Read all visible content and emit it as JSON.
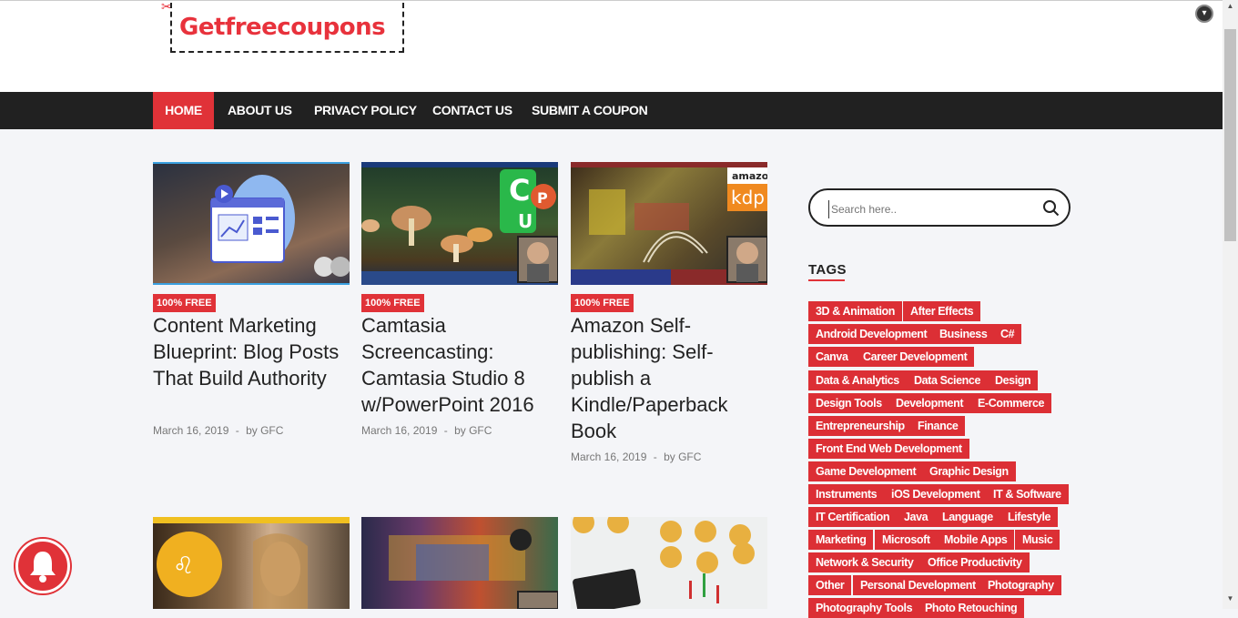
{
  "header": {
    "logo_text": "Getfreecoupons"
  },
  "nav": {
    "items": [
      {
        "label": "HOME"
      },
      {
        "label": "ABOUT US"
      },
      {
        "label": "PRIVACY POLICY"
      },
      {
        "label": "CONTACT US"
      },
      {
        "label": "SUBMIT A COUPON"
      }
    ]
  },
  "posts": [
    {
      "badge": "100% FREE",
      "title": "Content Marketing Blueprint: Blog Posts That Build Authority",
      "date": "March 16, 2019",
      "sep": "-",
      "author": "by GFC"
    },
    {
      "badge": "100% FREE",
      "title": "Camtasia Screencasting: Camtasia Studio 8 w/PowerPoint 2016",
      "date": "March 16, 2019",
      "sep": "-",
      "author": "by GFC"
    },
    {
      "badge": "100% FREE",
      "title": "Amazon Self-publishing: Self-publish a Kindle/Paperback Book",
      "date": "March 16, 2019",
      "sep": "-",
      "author": "by GFC"
    }
  ],
  "thumb_labels": {
    "amazon": "amazon",
    "kdp": "kdp"
  },
  "sidebar": {
    "search_placeholder": "Search here..",
    "tags_title": "TAGS",
    "tags": [
      "3D & Animation",
      "After Effects",
      "Android Development",
      "Business",
      "C#",
      "Canva",
      "Career Development",
      "Data & Analytics",
      "Data Science",
      "Design",
      "Design Tools",
      "Development",
      "E-Commerce",
      "Entrepreneurship",
      "Finance",
      "Front End Web Development",
      "Game Development",
      "Graphic Design",
      "Instruments",
      "iOS Development",
      "IT & Software",
      "IT Certification",
      "Java",
      "Language",
      "Lifestyle",
      "Marketing",
      "Microsoft",
      "Mobile Apps",
      "Music",
      "Network & Security",
      "Office Productivity",
      "Other",
      "Personal Development",
      "Photography",
      "Photography Tools",
      "Photo Retouching"
    ]
  },
  "colors": {
    "accent": "#e03238",
    "nav_bg": "#212121",
    "page_bg": "#f4f5f8"
  }
}
